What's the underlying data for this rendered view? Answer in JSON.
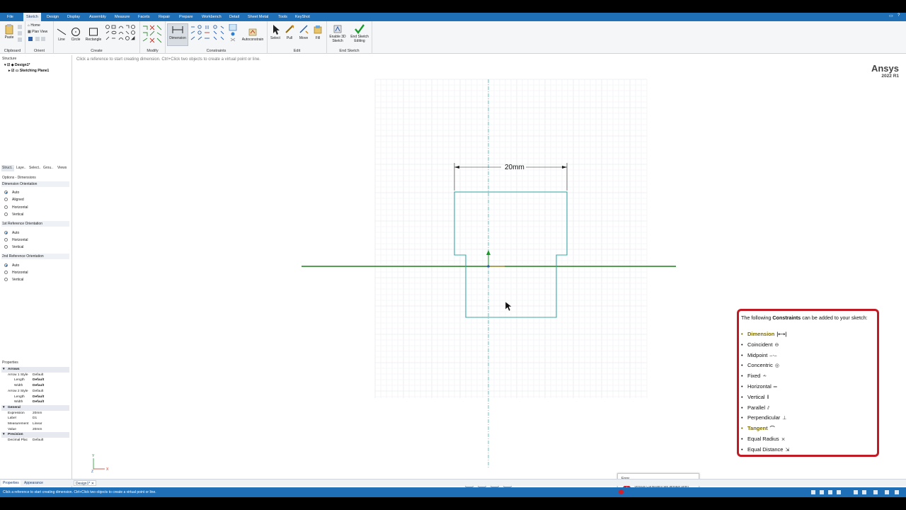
{
  "menu": {
    "items": [
      "File",
      "Sketch",
      "Design",
      "Display",
      "Assembly",
      "Measure",
      "Facets",
      "Repair",
      "Prepare",
      "Workbench",
      "Detail",
      "Sheet Metal",
      "Tools",
      "KeyShot"
    ],
    "active": "Sketch"
  },
  "ribbon": {
    "clipboard": {
      "label": "Clipboard",
      "paste": "Paste"
    },
    "orient": {
      "label": "Orient",
      "home": "Home",
      "plan_view": "Plan View"
    },
    "create": {
      "label": "Create",
      "line": "Line",
      "circle": "Circle",
      "rectangle": "Rectangle"
    },
    "modify": {
      "label": "Modify"
    },
    "constraints": {
      "label": "Constraints",
      "dimension": "Dimension",
      "autoconstrain": "Autoconstrain"
    },
    "edit": {
      "label": "Edit",
      "select": "Select",
      "pull": "Pull",
      "move": "Move",
      "fill": "Fill"
    },
    "end_sketch": {
      "label": "End Sketch",
      "enable_3d": "Enable 3D",
      "enable_3d_2": "Sketch",
      "end_editing": "End Sketch",
      "end_editing_2": "Editing"
    }
  },
  "structure": {
    "title": "Structure",
    "items": [
      "Design1*",
      "Sketching Plane1"
    ]
  },
  "panel_tabs": [
    "Struct..",
    "Laye..",
    "Select..",
    "Grou..",
    "Views"
  ],
  "options": {
    "title": "Options - Dimensions",
    "groups": [
      {
        "name": "Dimension Orientation",
        "options": [
          "Auto",
          "Aligned",
          "Horizontal",
          "Vertical"
        ],
        "selected": "Auto"
      },
      {
        "name": "1st Reference Orientation",
        "options": [
          "Auto",
          "Horizontal",
          "Vertical"
        ],
        "selected": "Auto"
      },
      {
        "name": "2nd Reference Orientation",
        "options": [
          "Auto",
          "Horizontal",
          "Vertical"
        ],
        "selected": "Auto"
      }
    ]
  },
  "properties": {
    "title": "Properties",
    "rows": [
      {
        "type": "cat",
        "k": "Arrows",
        "v": ""
      },
      {
        "type": "row",
        "k": "Arrow 1 Style",
        "v": "Default"
      },
      {
        "type": "sub",
        "k": "Length",
        "v": "Default",
        "bold": true
      },
      {
        "type": "sub",
        "k": "Width",
        "v": "Default",
        "bold": true
      },
      {
        "type": "row",
        "k": "Arrow 2 Style",
        "v": "Default"
      },
      {
        "type": "sub",
        "k": "Length",
        "v": "Default",
        "bold": true
      },
      {
        "type": "sub",
        "k": "Width",
        "v": "Default",
        "bold": true
      },
      {
        "type": "cat",
        "k": "General",
        "v": ""
      },
      {
        "type": "row",
        "k": "Expression",
        "v": "20mm"
      },
      {
        "type": "row",
        "k": "Label",
        "v": "D1"
      },
      {
        "type": "row",
        "k": "Measurement",
        "v": "Linear"
      },
      {
        "type": "row",
        "k": "Value",
        "v": "20mm"
      },
      {
        "type": "cat",
        "k": "Precision",
        "v": ""
      },
      {
        "type": "row",
        "k": "Decimal Plac",
        "v": "Default"
      }
    ]
  },
  "bottom_tabs": [
    "Properties",
    "Appearance"
  ],
  "doc_tab": "Design1*",
  "canvas": {
    "hint": "Click a reference to start creating dimension. Ctrl+Click two objects to create a virtual point or line.",
    "brand": "Ansys",
    "version": "2022 R1",
    "dimension_label": "20mm",
    "axis_x": "X",
    "axis_y": "Y",
    "axis_z": "Z"
  },
  "constraints_panel": {
    "head_pre": "The following ",
    "head_bold": "Constraints",
    "head_post": " can be added to your sketch:",
    "items": [
      {
        "label": "Dimension",
        "icon": "dimension-icon",
        "hl": true
      },
      {
        "label": "Coincident",
        "icon": "coincident-icon",
        "hl": false
      },
      {
        "label": "Midpoint",
        "icon": "midpoint-icon",
        "hl": false
      },
      {
        "label": "Concentric",
        "icon": "concentric-icon",
        "hl": false
      },
      {
        "label": "Fixed",
        "icon": "fixed-icon",
        "hl": false
      },
      {
        "label": "Horizontal",
        "icon": "horizontal-icon",
        "hl": false
      },
      {
        "label": "Vertical",
        "icon": "vertical-icon",
        "hl": false
      },
      {
        "label": "Parallel",
        "icon": "parallel-icon",
        "hl": false
      },
      {
        "label": "Perpendicular",
        "icon": "perpendicular-icon",
        "hl": false
      },
      {
        "label": "Tangent",
        "icon": "tangent-icon",
        "hl": true
      },
      {
        "label": "Equal Radius",
        "icon": "equal-radius-icon",
        "hl": false
      },
      {
        "label": "Equal Distance",
        "icon": "equal-distance-icon",
        "hl": false
      }
    ]
  },
  "error": {
    "title": "Error",
    "message": "Vertical Constraint has already been defined with input sketch entities"
  },
  "status": {
    "text": "Click a reference to start creating dimension. Ctrl+Click two objects to create a virtual point or line."
  },
  "colors": {
    "accent": "#1f6fb7",
    "sketch": "#3aa7a7",
    "axis_green": "#1a7f1a",
    "panel_border": "#c01a24"
  }
}
